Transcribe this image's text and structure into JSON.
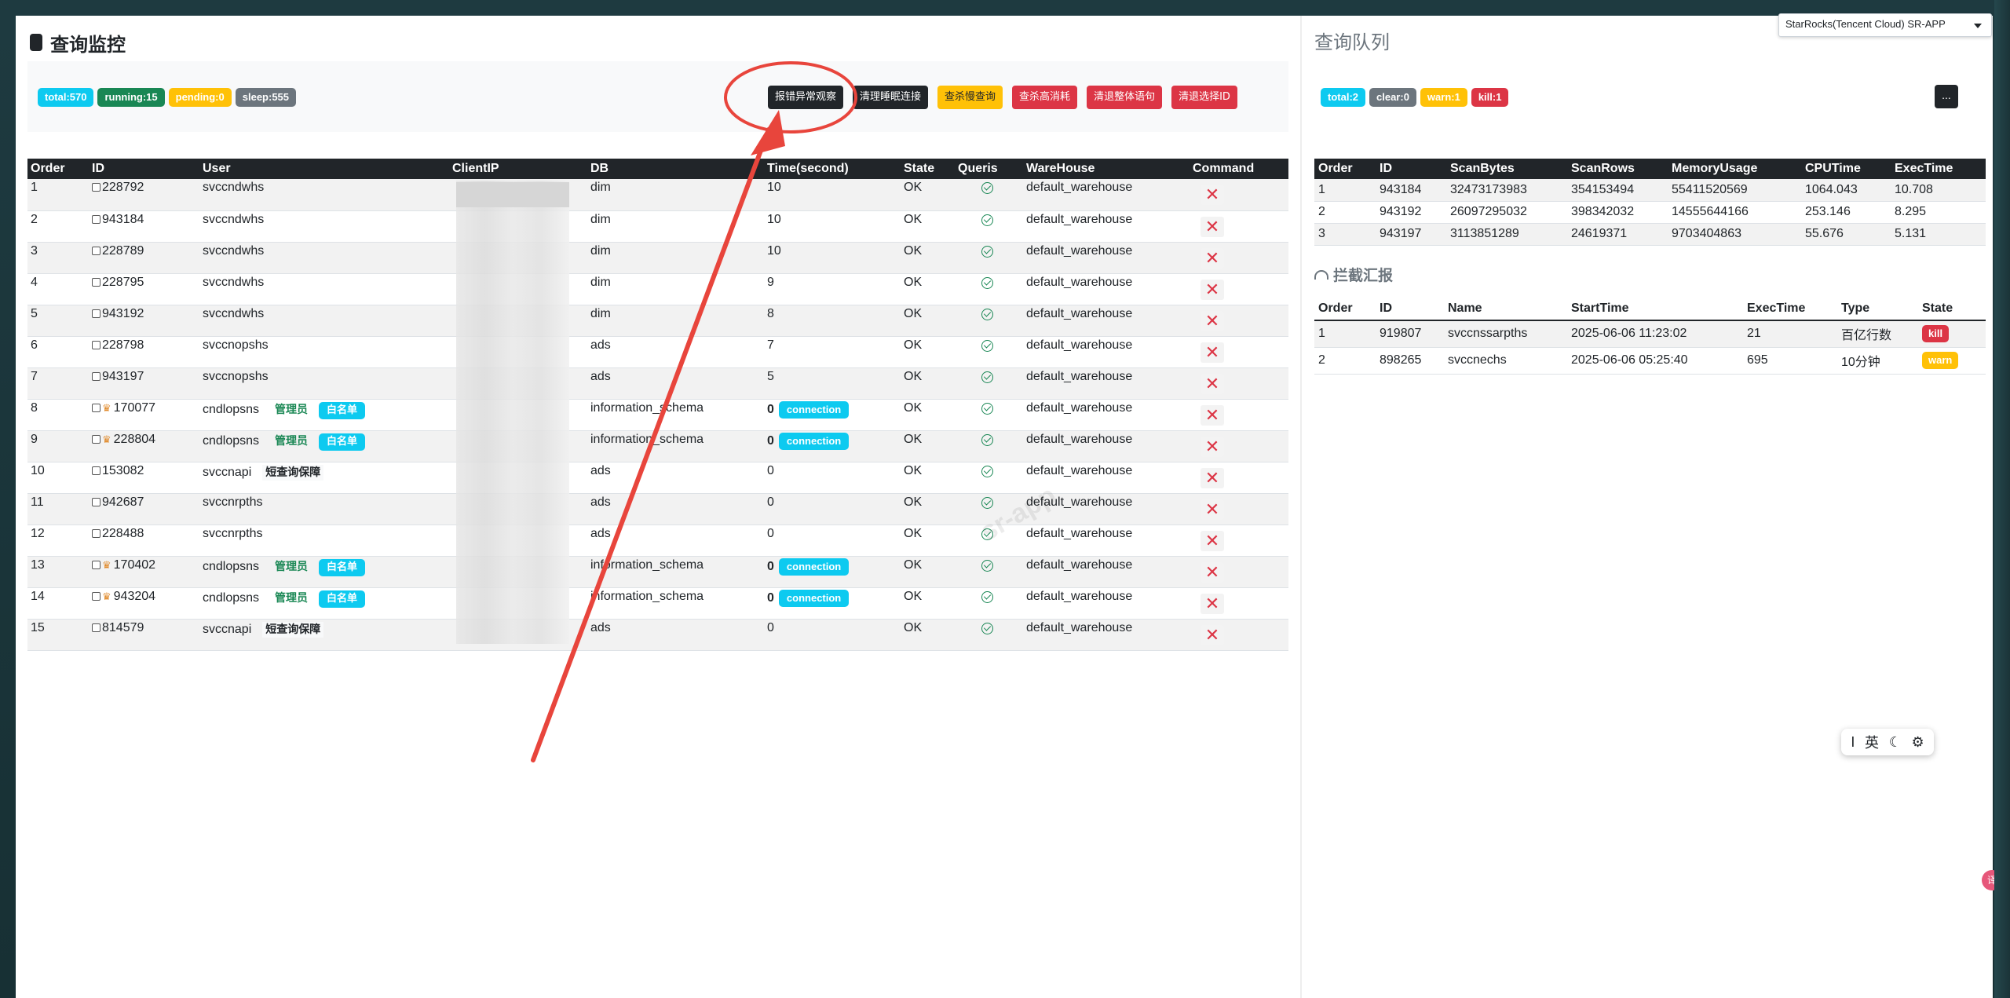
{
  "left": {
    "title": "查询监控",
    "badges": [
      {
        "label": "total:570",
        "color": "#0dcaf0"
      },
      {
        "label": "running:15",
        "color": "#198754"
      },
      {
        "label": "pending:0",
        "color": "#ffc107"
      },
      {
        "label": "sleep:555",
        "color": "#6c757d"
      }
    ],
    "actions": {
      "abnormal": "报错异常观察",
      "clear_sleep": "清理睡眠连接",
      "kill_slow": "查杀慢查询",
      "kill_high": "查杀高消耗",
      "kill_stmt": "清退整体语句",
      "kill_selected": "清退选择ID"
    },
    "columns": [
      "Order",
      "ID",
      "User",
      "ClientIP",
      "DB",
      "Time(second)",
      "State",
      "Queris",
      "WareHouse",
      "Command"
    ],
    "rows": [
      {
        "order": "1",
        "id": "228792",
        "user": "svccndwhs",
        "db": "dim",
        "time": "10",
        "state": "OK",
        "wh": "default_warehouse"
      },
      {
        "order": "2",
        "id": "943184",
        "user": "svccndwhs",
        "db": "dim",
        "time": "10",
        "state": "OK",
        "wh": "default_warehouse"
      },
      {
        "order": "3",
        "id": "228789",
        "user": "svccndwhs",
        "db": "dim",
        "time": "10",
        "state": "OK",
        "wh": "default_warehouse"
      },
      {
        "order": "4",
        "id": "228795",
        "user": "svccndwhs",
        "db": "dim",
        "time": "9",
        "state": "OK",
        "wh": "default_warehouse"
      },
      {
        "order": "5",
        "id": "943192",
        "user": "svccndwhs",
        "db": "dim",
        "time": "8",
        "state": "OK",
        "wh": "default_warehouse"
      },
      {
        "order": "6",
        "id": "228798",
        "user": "svccnopshs",
        "db": "ads",
        "time": "7",
        "state": "OK",
        "wh": "default_warehouse"
      },
      {
        "order": "7",
        "id": "943197",
        "user": "svccnopshs",
        "db": "ads",
        "time": "5",
        "state": "OK",
        "wh": "default_warehouse"
      },
      {
        "order": "8",
        "id": "170077",
        "user": "cndlopsns",
        "db": "information_schema",
        "time": "0",
        "state": "OK",
        "wh": "default_warehouse"
      },
      {
        "order": "9",
        "id": "228804",
        "user": "cndlopsns",
        "db": "information_schema",
        "time": "0",
        "state": "OK",
        "wh": "default_warehouse"
      },
      {
        "order": "10",
        "id": "153082",
        "user": "svccnapi",
        "db": "ads",
        "time": "0",
        "state": "OK",
        "wh": "default_warehouse"
      },
      {
        "order": "11",
        "id": "942687",
        "user": "svccnrpths",
        "db": "ads",
        "time": "0",
        "state": "OK",
        "wh": "default_warehouse"
      },
      {
        "order": "12",
        "id": "228488",
        "user": "svccnrpths",
        "db": "ads",
        "time": "0",
        "state": "OK",
        "wh": "default_warehouse"
      },
      {
        "order": "13",
        "id": "170402",
        "user": "cndlopsns",
        "db": "information_schema",
        "time": "0",
        "state": "OK",
        "wh": "default_warehouse"
      },
      {
        "order": "14",
        "id": "943204",
        "user": "cndlopsns",
        "db": "information_schema",
        "time": "0",
        "state": "OK",
        "wh": "default_warehouse"
      },
      {
        "order": "15",
        "id": "814579",
        "user": "svccnapi",
        "db": "ads",
        "time": "0",
        "state": "OK",
        "wh": "default_warehouse"
      }
    ],
    "tags": {
      "admin": "管理员",
      "whitelist": "白名单",
      "short_guard": "短查询保障",
      "connection": "connection"
    },
    "kill_glyph": "✕",
    "watermark": "sr-app"
  },
  "right": {
    "title": "查询队列",
    "cluster": "StarRocks(Tencent Cloud) SR-APP",
    "badges": [
      {
        "label": "total:2",
        "color": "#0dcaf0"
      },
      {
        "label": "clear:0",
        "color": "#6c757d"
      },
      {
        "label": "warn:1",
        "color": "#ffc107"
      },
      {
        "label": "kill:1",
        "color": "#dc3545"
      }
    ],
    "more": "...",
    "queue_columns": [
      "Order",
      "ID",
      "ScanBytes",
      "ScanRows",
      "MemoryUsage",
      "CPUTime",
      "ExecTime"
    ],
    "queue_rows": [
      [
        "1",
        "943184",
        "32473173983",
        "354153494",
        "55411520569",
        "1064.043",
        "10.708"
      ],
      [
        "2",
        "943192",
        "26097295032",
        "398342032",
        "14555644166",
        "253.146",
        "8.295"
      ],
      [
        "3",
        "943197",
        "3113851289",
        "24619371",
        "9703404863",
        "55.676",
        "5.131"
      ]
    ],
    "intercept_title": "拦截汇报",
    "intercept_columns": [
      "Order",
      "ID",
      "Name",
      "StartTime",
      "ExecTime",
      "Type",
      "State"
    ],
    "intercept_rows": [
      {
        "order": "1",
        "id": "919807",
        "name": "svccnssarpths",
        "start": "2025-06-06 11:23:02",
        "exec": "21",
        "type": "百亿行数",
        "state": "kill",
        "state_color": "#dc3545"
      },
      {
        "order": "2",
        "id": "898265",
        "name": "svccnechs",
        "start": "2025-06-06 05:25:40",
        "exec": "695",
        "type": "10分钟",
        "state": "warn",
        "state_color": "#ffc107"
      }
    ]
  },
  "ime": {
    "cursor": "I",
    "lang": "英",
    "moon": "☾",
    "gear": "⚙"
  },
  "side_float": "译",
  "annotation_color": "#e8453c"
}
